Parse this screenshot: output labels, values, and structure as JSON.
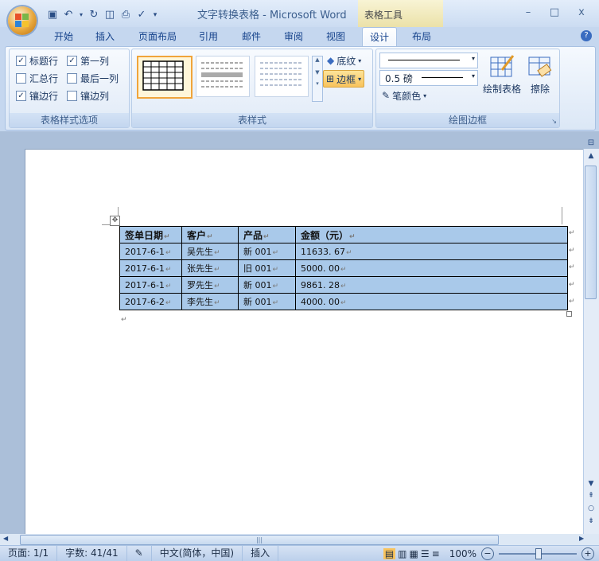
{
  "titlebar": {
    "title": "文字转换表格 - Microsoft Word",
    "context_title": "表格工具",
    "minimize": "–",
    "maximize": "□",
    "close": "x"
  },
  "tabs": [
    "开始",
    "插入",
    "页面布局",
    "引用",
    "邮件",
    "审阅",
    "视图",
    "设计",
    "布局"
  ],
  "active_tab": "设计",
  "help": "?",
  "options_group": {
    "label": "表格样式选项",
    "items": [
      {
        "label": "标题行",
        "checked": true
      },
      {
        "label": "第一列",
        "checked": true
      },
      {
        "label": "汇总行",
        "checked": false
      },
      {
        "label": "最后一列",
        "checked": false
      },
      {
        "label": "镶边行",
        "checked": true
      },
      {
        "label": "镶边列",
        "checked": false
      }
    ]
  },
  "styles_group": {
    "label": "表样式",
    "shading_label": "底纹",
    "borders_label": "边框"
  },
  "draw_group": {
    "label": "绘图边框",
    "weight_value": "0.5 磅",
    "pen_color_label": "笔颜色",
    "draw_table_label": "绘制表格",
    "eraser_label": "擦除"
  },
  "table": {
    "headers": [
      "签单日期",
      "客户",
      "产品",
      "金额（元）"
    ],
    "rows": [
      [
        "2017-6-1",
        "吴先生",
        "新 001",
        "11633. 67"
      ],
      [
        "2017-6-1",
        "张先生",
        "旧 001",
        "5000. 00"
      ],
      [
        "2017-6-1",
        "罗先生",
        "新 001",
        "9861. 28"
      ],
      [
        "2017-6-2",
        "李先生",
        "新 001",
        "4000. 00"
      ]
    ]
  },
  "status": {
    "page": "页面: 1/1",
    "words": "字数: 41/41",
    "language": "中文(简体，中国)",
    "mode": "插入",
    "zoom": "100%"
  },
  "colors": {
    "table_fill": "#a9c9ea",
    "ribbon_accent": "#15428b",
    "highlight": "#f8c35c"
  }
}
